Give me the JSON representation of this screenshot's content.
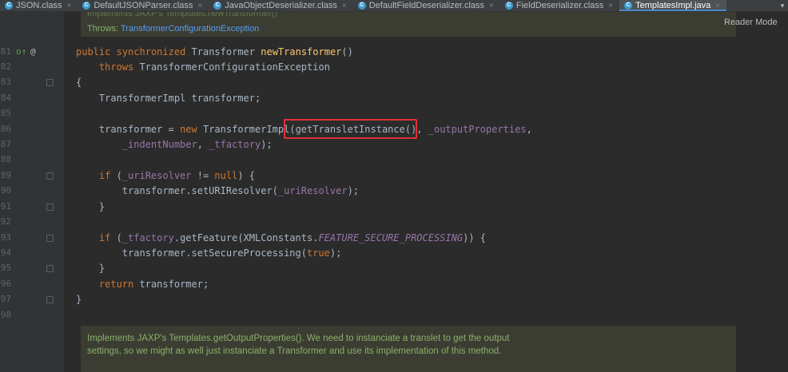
{
  "tabs": [
    {
      "label": "JSON.class",
      "active": false
    },
    {
      "label": "DefaultJSONParser.class",
      "active": false
    },
    {
      "label": "JavaObjectDeserializer.class",
      "active": false
    },
    {
      "label": "DefaultFieldDeserializer.class",
      "active": false
    },
    {
      "label": "FieldDeserializer.class",
      "active": false
    },
    {
      "label": "TemplatesImpl.java",
      "active": true
    }
  ],
  "tab_icon_letter": "C",
  "tab_overflow_icon": "chevron-down-icon",
  "reader_mode_label": "Reader Mode",
  "doc_top": {
    "partial_line": "Implements JAXP's Templates.newTransformer()",
    "throws_label": "Throws:",
    "throws_link": "TransformerConfigurationException"
  },
  "line_numbers": [
    "81",
    "82",
    "83",
    "84",
    "85",
    "86",
    "87",
    "88",
    "89",
    "90",
    "91",
    "92",
    "93",
    "94",
    "95",
    "96",
    "97",
    "98"
  ],
  "gutter_marks": {
    "override_icon": "override-icon",
    "override_glyph": "o↑",
    "at_glyph": "@"
  },
  "code": {
    "l81": {
      "kw1": "public",
      "kw2": "synchronized",
      "type": "Transformer",
      "method": "newTransformer",
      "rest": "()"
    },
    "l82": {
      "kw": "throws",
      "type": "TransformerConfigurationException"
    },
    "l83": {
      "text": "{"
    },
    "l84": {
      "text": "TransformerImpl transformer;"
    },
    "l86": {
      "pre": "transformer = ",
      "kw": "new",
      "mid": " TransformerImpl(",
      "call": "getTransletInstance()",
      "comma": ", ",
      "field": "_outputProperties",
      "end": ","
    },
    "l87": {
      "field1": "_indentNumber",
      "sep": ", ",
      "field2": "_tfactory",
      "end": ");"
    },
    "l89": {
      "kw": "if",
      "pre": " (",
      "field": "_uriResolver",
      "op": " != ",
      "kw2": "null",
      "end": ") {"
    },
    "l90": {
      "pre": "transformer.setURIResolver(",
      "field": "_uriResolver",
      "end": ");"
    },
    "l91": {
      "text": "}"
    },
    "l93": {
      "kw": "if",
      "pre": " (",
      "field": "_tfactory",
      "mid": ".getFeature(XMLConstants.",
      "constant": "FEATURE_SECURE_PROCESSING",
      "end": ")) {"
    },
    "l94": {
      "pre": "transformer.setSecureProcessing(",
      "kw": "true",
      "end": ");"
    },
    "l95": {
      "text": "}"
    },
    "l96": {
      "kw": "return",
      "rest": " transformer;"
    },
    "l97": {
      "text": "}"
    }
  },
  "doc_bottom": "Implements JAXP's Templates.getOutputProperties(). We need to instanciate a translet to get the output settings, so we might as well just instanciate a Transformer and use its implementation of this method.",
  "colors": {
    "background": "#2b2b2b",
    "keyword": "#cc7832",
    "method": "#ffc66d",
    "field": "#9876aa",
    "doc_text": "#8bb06a",
    "highlight": "#e2303a",
    "active_tab_accent": "#4a88c7"
  }
}
